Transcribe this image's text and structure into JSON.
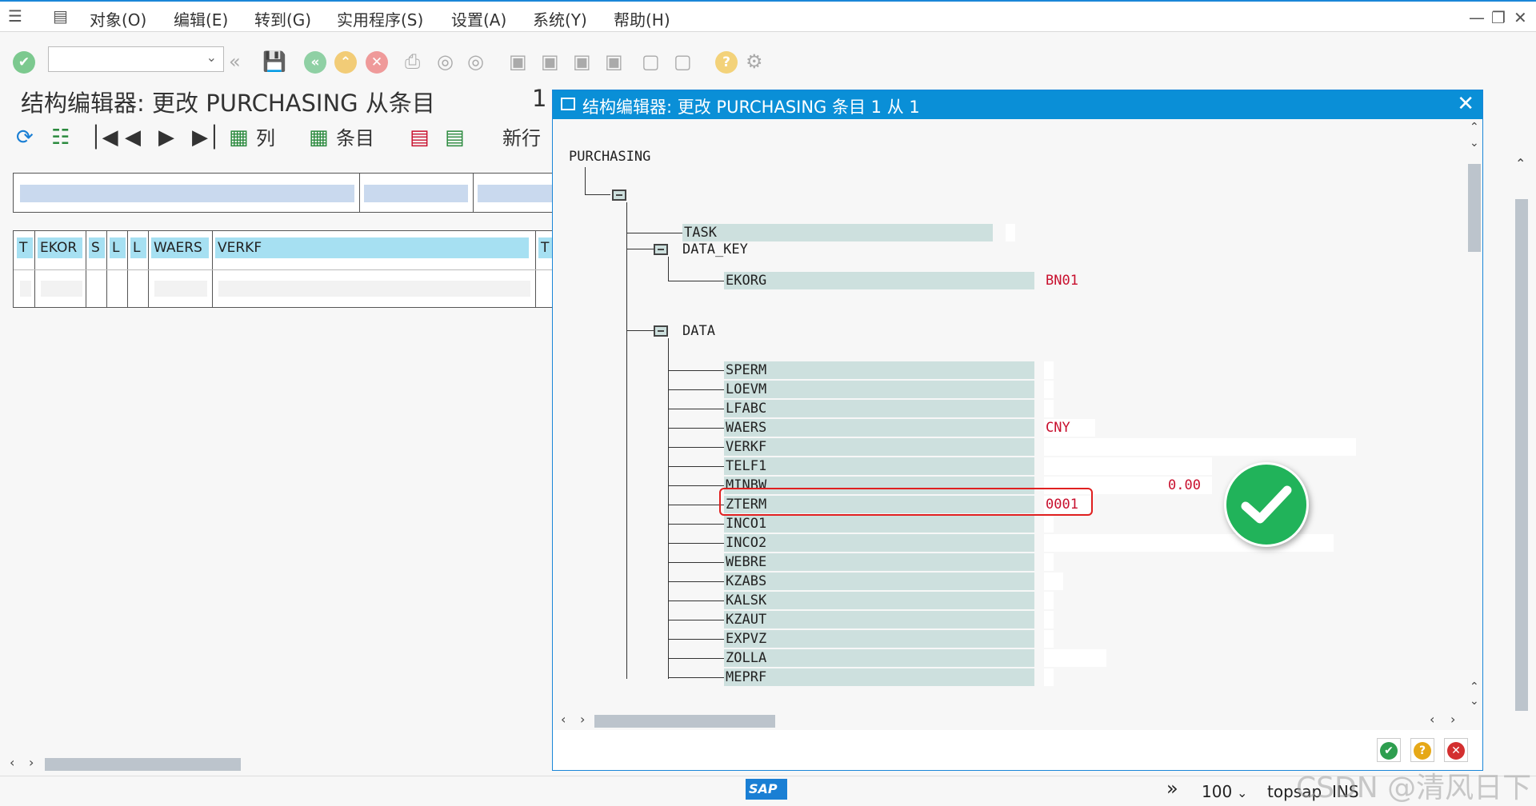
{
  "menubar": {
    "items": [
      "对象(O)",
      "编辑(E)",
      "转到(G)",
      "实用程序(S)",
      "设置(A)",
      "系统(Y)",
      "帮助(H)"
    ]
  },
  "toolbar": {
    "command_value": ""
  },
  "main": {
    "title": "结构编辑器: 更改 PURCHASING 从条目",
    "entry_number": "1",
    "app_toolbar": {
      "col_label": "列",
      "entry_label": "条目",
      "new_row_label": "新行"
    },
    "grid_headers": [
      "T",
      "EKOR",
      "S",
      "L",
      "L",
      "WAERS",
      "VERKF",
      "T"
    ]
  },
  "dialog": {
    "title": "结构编辑器: 更改 PURCHASING 条目 1 从 1",
    "root": "PURCHASING",
    "task_label": "TASK",
    "data_key": {
      "label": "DATA_KEY",
      "fields": [
        {
          "name": "EKORG",
          "value": "BN01"
        }
      ]
    },
    "data": {
      "label": "DATA",
      "fields": [
        {
          "name": "SPERM",
          "value": ""
        },
        {
          "name": "LOEVM",
          "value": ""
        },
        {
          "name": "LFABC",
          "value": ""
        },
        {
          "name": "WAERS",
          "value": "CNY"
        },
        {
          "name": "VERKF",
          "value": ""
        },
        {
          "name": "TELF1",
          "value": ""
        },
        {
          "name": "MINBW",
          "value": "0.00"
        },
        {
          "name": "ZTERM",
          "value": "0001"
        },
        {
          "name": "INCO1",
          "value": ""
        },
        {
          "name": "INCO2",
          "value": ""
        },
        {
          "name": "WEBRE",
          "value": ""
        },
        {
          "name": "KZABS",
          "value": ""
        },
        {
          "name": "KALSK",
          "value": ""
        },
        {
          "name": "KZAUT",
          "value": ""
        },
        {
          "name": "EXPVZ",
          "value": ""
        },
        {
          "name": "ZOLLA",
          "value": ""
        },
        {
          "name": "MEPRF",
          "value": ""
        }
      ]
    }
  },
  "status": {
    "zoom": "100",
    "system": "topsap",
    "mode": "INS"
  },
  "watermark": "CSDN @清风日下",
  "colors": {
    "accent": "#0a8fd7",
    "field_bg": "#cde0de",
    "value_text": "#c8102e",
    "grid_header": "#a6e0f2",
    "success": "#21b35a",
    "highlight": "#e02020"
  }
}
